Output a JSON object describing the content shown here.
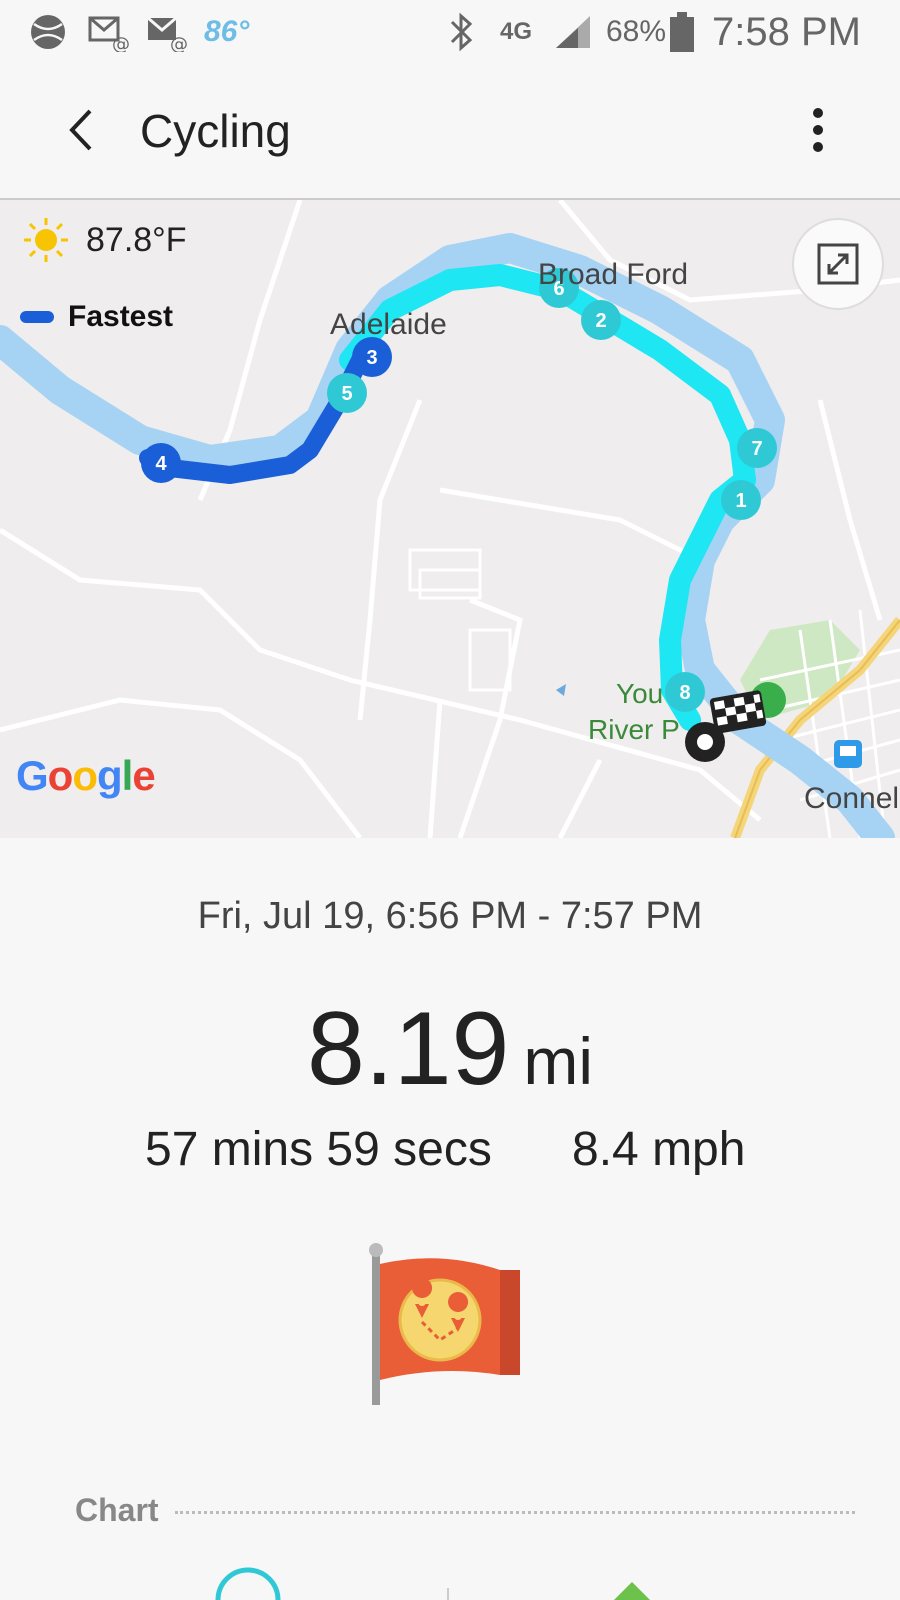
{
  "status_bar": {
    "weather_temp": "86°",
    "network": "4G",
    "battery": "68%",
    "time": "7:58 PM",
    "icons": [
      "ball-icon",
      "mail-at-icon",
      "mail-at-icon",
      "bluetooth-icon",
      "lte-icon",
      "signal-icon",
      "battery-icon"
    ]
  },
  "app_bar": {
    "title": "Cycling",
    "back_icon": "chevron-left-icon",
    "menu_icon": "more-vert-icon"
  },
  "map": {
    "weather_temp": "87.8°F",
    "legend_label": "Fastest",
    "places": [
      "Broad Ford",
      "Adelaide",
      "You",
      "River P",
      "Connel"
    ],
    "markers": [
      "1",
      "2",
      "3",
      "4",
      "5",
      "6",
      "7",
      "8"
    ],
    "attribution": "Google",
    "colors": {
      "route_fast": "#1a5fd8",
      "route_normal": "#1ee6f2",
      "river": "#a6d3f3"
    }
  },
  "summary": {
    "date_range": "Fri, Jul 19, 6:56 PM - 7:57 PM",
    "distance_value": "8.19",
    "distance_unit": "mi",
    "duration": "57 mins 59 secs",
    "speed": "8.4 mph"
  },
  "chart": {
    "title": "Chart"
  }
}
